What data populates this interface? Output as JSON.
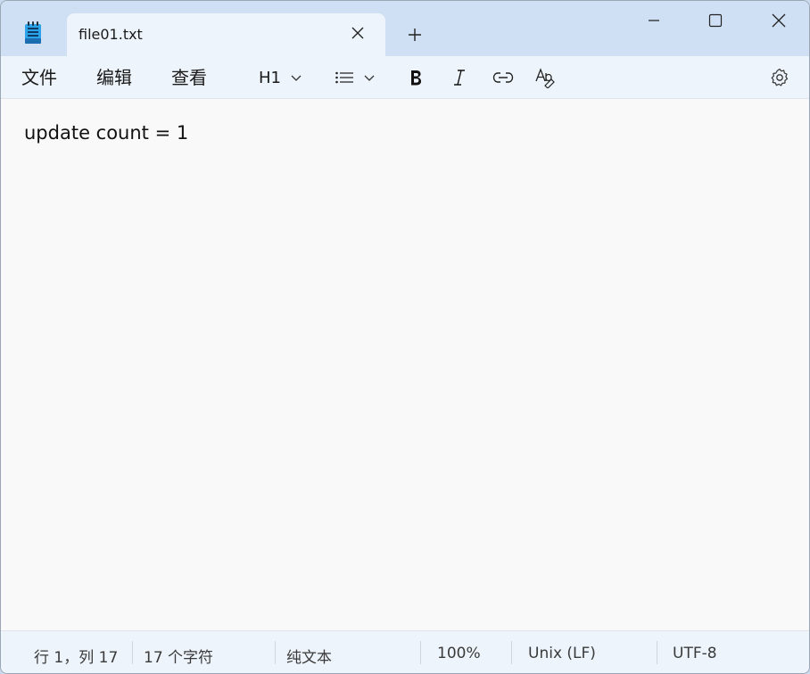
{
  "window": {
    "tab_title": "file01.txt",
    "controls": [
      "minimize-icon",
      "maximize-icon",
      "close-icon"
    ]
  },
  "menu": {
    "file": "文件",
    "edit": "编辑",
    "view": "查看"
  },
  "toolbar": {
    "heading_label": "H1",
    "icons": [
      "chevron-down-icon",
      "list-icon",
      "bold-icon",
      "italic-icon",
      "link-icon",
      "spellcheck-icon",
      "settings-icon"
    ]
  },
  "editor": {
    "content": "update count = 1"
  },
  "status": {
    "position": "行 1，列 17",
    "chars": "17 个字符",
    "type": "纯文本",
    "zoom": "100%",
    "line_ending": "Unix (LF)",
    "encoding": "UTF-8"
  },
  "colors": {
    "titlebar": "#cfe0f4",
    "tab": "#eef4fb",
    "editor_bg": "#f9f9f9",
    "accent": "#0f6cbd"
  }
}
